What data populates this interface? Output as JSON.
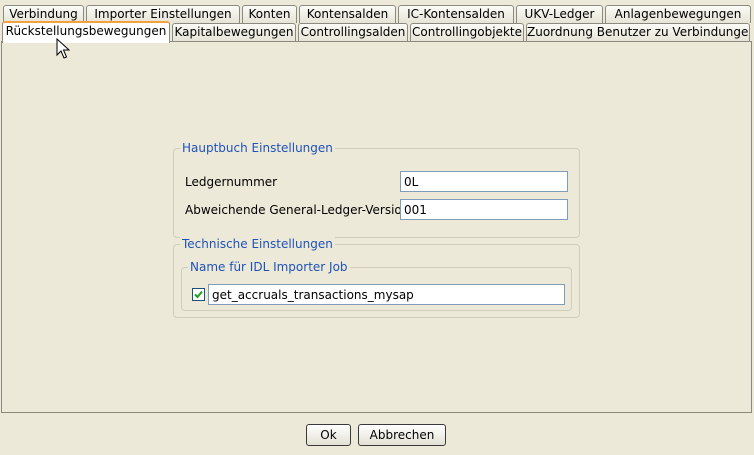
{
  "tabs_row1": [
    {
      "label": "Verbindung"
    },
    {
      "label": "Importer Einstellungen"
    },
    {
      "label": "Konten"
    },
    {
      "label": "Kontensalden"
    },
    {
      "label": "IC-Kontensalden"
    },
    {
      "label": "UKV-Ledger"
    },
    {
      "label": "Anlagenbewegungen"
    }
  ],
  "tabs_row2": [
    {
      "label": "Rückstellungsbewegungen",
      "active": true
    },
    {
      "label": "Kapitalbewegungen"
    },
    {
      "label": "Controllingsalden"
    },
    {
      "label": "Controllingobjekte"
    },
    {
      "label": "Zuordnung Benutzer zu Verbindungen"
    }
  ],
  "hauptbuch": {
    "title": "Hauptbuch Einstellungen",
    "ledger_label": "Ledgernummer",
    "ledger_value": "0L",
    "version_label": "Abweichende General-Ledger-Version",
    "version_value": "001"
  },
  "technisch": {
    "title": "Technische Einstellungen",
    "job_group_title": "Name für IDL Importer Job",
    "job_checked": true,
    "job_value": "get_accruals_transactions_mysap"
  },
  "buttons": {
    "ok": "Ok",
    "cancel": "Abbrechen"
  }
}
